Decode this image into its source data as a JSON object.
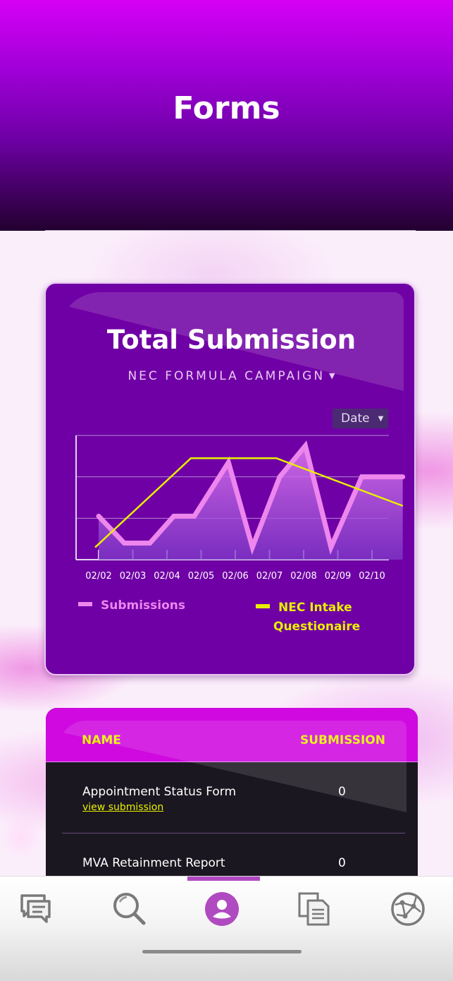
{
  "header": {
    "title": "Forms"
  },
  "chart_card": {
    "title": "Total Submission",
    "campaign_label": "NEC FORMULA CAMPAIGN",
    "campaign_caret": "▼",
    "date_filter": {
      "label": "Date",
      "caret": "▼"
    },
    "legend": {
      "submissions": "Submissions",
      "nec_line1": "NEC Intake",
      "nec_line2": "Questionaire"
    }
  },
  "chart_data": {
    "type": "line",
    "categories": [
      "02/02",
      "02/03",
      "02/04",
      "02/05",
      "02/06",
      "02/07",
      "02/08",
      "02/09",
      "02/10"
    ],
    "ylim": [
      0,
      6
    ],
    "grid": true,
    "legend_placement": "bottom",
    "series": [
      {
        "name": "Submissions",
        "style": "area",
        "color": "#ee86ee",
        "x": [
          0,
          0.75,
          1.5,
          2.2,
          2.8,
          3.8,
          4.5,
          5.3,
          6.05,
          6.8,
          7.7,
          8.5,
          8.9
        ],
        "values": [
          2.1,
          0.8,
          0.8,
          2.1,
          2.1,
          4.7,
          0.6,
          4.0,
          5.5,
          0.6,
          4.0,
          4.0,
          4.0
        ]
      },
      {
        "name": "NEC Intake Questionaire",
        "style": "line",
        "color": "#e8f000",
        "x": [
          -0.1,
          2.7,
          5.2,
          8.9
        ],
        "values": [
          0.6,
          4.9,
          4.9,
          2.6
        ]
      }
    ]
  },
  "table": {
    "headers": {
      "name": "NAME",
      "submission": "SUBMISSION"
    },
    "rows": [
      {
        "name": "Appointment Status Form",
        "value": "0",
        "link": "view submission"
      },
      {
        "name": "MVA Retainment Report",
        "value": "0"
      }
    ]
  },
  "tabbar": {
    "tabs": [
      {
        "icon": "chat-icon"
      },
      {
        "icon": "search-icon"
      },
      {
        "icon": "profile-icon",
        "active": true
      },
      {
        "icon": "documents-icon"
      },
      {
        "icon": "network-globe-icon"
      }
    ],
    "active_color": "#b04ac0",
    "icon_color": "#7a7a7a"
  },
  "colors": {
    "card_bg": "#6f00a5",
    "accent_yellow": "#e8f000",
    "accent_pink": "#ee86ee",
    "table_head": "#cf09e0"
  }
}
